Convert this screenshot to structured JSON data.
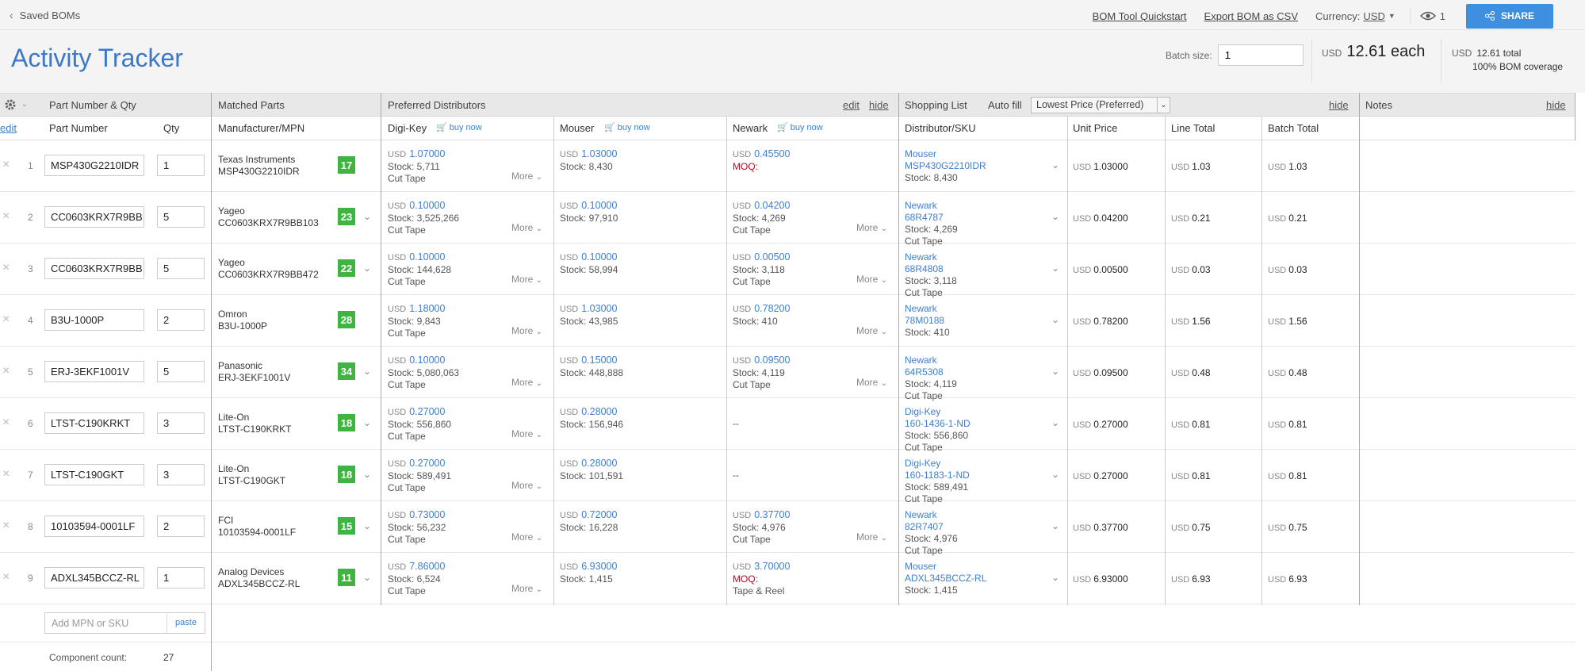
{
  "topbar": {
    "back_label": "Saved BOMs",
    "quickstart": "BOM Tool Quickstart",
    "export": "Export BOM as CSV",
    "currency_label": "Currency:",
    "currency_value": "USD",
    "viewers": "1",
    "share": "SHARE"
  },
  "header": {
    "title": "Activity Tracker",
    "batch_label": "Batch size:",
    "batch_value": "1",
    "each_currency": "USD",
    "each_value": "12.61 each",
    "total_currency": "USD",
    "total_value": "12.61 total",
    "coverage": "100% BOM coverage"
  },
  "groups": {
    "part": "Part Number & Qty",
    "matched": "Matched Parts",
    "preferred": "Preferred Distributors",
    "edit": "edit",
    "hide": "hide",
    "shopping": "Shopping List",
    "autofill": "Auto fill",
    "autofill_value": "Lowest Price (Preferred)",
    "notes": "Notes"
  },
  "columns": {
    "edit": "edit",
    "part_number": "Part Number",
    "qty": "Qty",
    "mfr": "Manufacturer/MPN",
    "digikey": "Digi-Key",
    "mouser": "Mouser",
    "newark": "Newark",
    "buy_now": "buy now",
    "sku": "Distributor/SKU",
    "unit": "Unit Price",
    "line": "Line Total",
    "batch": "Batch Total"
  },
  "rows": [
    {
      "n": "1",
      "part": "MSP430G2210IDR",
      "qty": "1",
      "mfr": "Texas Instruments",
      "mpn": "MSP430G2210IDR",
      "badge": "17",
      "dk": [
        "USD",
        "1.07000",
        "Stock: 5,711",
        "Cut Tape"
      ],
      "mo": [
        "USD",
        "1.03000",
        "Stock: 8,430",
        ""
      ],
      "nw": [
        "USD",
        "0.45500",
        "MOQ:",
        ""
      ],
      "sl": [
        "Mouser",
        "MSP430G2210IDR",
        "Stock: 8,430",
        ""
      ],
      "unit": "1.03000",
      "line": "1.03",
      "batch": "1.03"
    },
    {
      "n": "2",
      "part": "CC0603KRX7R9BB",
      "qty": "5",
      "mfr": "Yageo",
      "mpn": "CC0603KRX7R9BB103",
      "badge": "23",
      "dk": [
        "USD",
        "0.10000",
        "Stock: 3,525,266",
        "Cut Tape"
      ],
      "mo": [
        "USD",
        "0.10000",
        "Stock: 97,910",
        ""
      ],
      "nw": [
        "USD",
        "0.04200",
        "Stock: 4,269",
        "Cut Tape"
      ],
      "sl": [
        "Newark",
        "68R4787",
        "Stock: 4,269",
        "Cut Tape"
      ],
      "unit": "0.04200",
      "line": "0.21",
      "batch": "0.21"
    },
    {
      "n": "3",
      "part": "CC0603KRX7R9BB",
      "qty": "5",
      "mfr": "Yageo",
      "mpn": "CC0603KRX7R9BB472",
      "badge": "22",
      "dk": [
        "USD",
        "0.10000",
        "Stock: 144,628",
        "Cut Tape"
      ],
      "mo": [
        "USD",
        "0.10000",
        "Stock: 58,994",
        ""
      ],
      "nw": [
        "USD",
        "0.00500",
        "Stock: 3,118",
        "Cut Tape"
      ],
      "sl": [
        "Newark",
        "68R4808",
        "Stock: 3,118",
        "Cut Tape"
      ],
      "unit": "0.00500",
      "line": "0.03",
      "batch": "0.03"
    },
    {
      "n": "4",
      "part": "B3U-1000P",
      "qty": "2",
      "mfr": "Omron",
      "mpn": "B3U-1000P",
      "badge": "28",
      "dk": [
        "USD",
        "1.18000",
        "Stock: 9,843",
        "Cut Tape"
      ],
      "mo": [
        "USD",
        "1.03000",
        "Stock: 43,985",
        ""
      ],
      "nw": [
        "USD",
        "0.78200",
        "Stock: 410",
        ""
      ],
      "sl": [
        "Newark",
        "78M0188",
        "Stock: 410",
        ""
      ],
      "unit": "0.78200",
      "line": "1.56",
      "batch": "1.56"
    },
    {
      "n": "5",
      "part": "ERJ-3EKF1001V",
      "qty": "5",
      "mfr": "Panasonic",
      "mpn": "ERJ-3EKF1001V",
      "badge": "34",
      "dk": [
        "USD",
        "0.10000",
        "Stock: 5,080,063",
        "Cut Tape"
      ],
      "mo": [
        "USD",
        "0.15000",
        "Stock: 448,888",
        ""
      ],
      "nw": [
        "USD",
        "0.09500",
        "Stock: 4,119",
        "Cut Tape"
      ],
      "sl": [
        "Newark",
        "64R5308",
        "Stock: 4,119",
        "Cut Tape"
      ],
      "unit": "0.09500",
      "line": "0.48",
      "batch": "0.48"
    },
    {
      "n": "6",
      "part": "LTST-C190KRKT",
      "qty": "3",
      "mfr": "Lite-On",
      "mpn": "LTST-C190KRKT",
      "badge": "18",
      "dk": [
        "USD",
        "0.27000",
        "Stock: 556,860",
        "Cut Tape"
      ],
      "mo": [
        "USD",
        "0.28000",
        "Stock: 156,946",
        ""
      ],
      "nw": [
        "",
        "--",
        "",
        ""
      ],
      "sl": [
        "Digi-Key",
        "160-1436-1-ND",
        "Stock: 556,860",
        "Cut Tape"
      ],
      "unit": "0.27000",
      "line": "0.81",
      "batch": "0.81"
    },
    {
      "n": "7",
      "part": "LTST-C190GKT",
      "qty": "3",
      "mfr": "Lite-On",
      "mpn": "LTST-C190GKT",
      "badge": "18",
      "dk": [
        "USD",
        "0.27000",
        "Stock: 589,491",
        "Cut Tape"
      ],
      "mo": [
        "USD",
        "0.28000",
        "Stock: 101,591",
        ""
      ],
      "nw": [
        "",
        "--",
        "",
        ""
      ],
      "sl": [
        "Digi-Key",
        "160-1183-1-ND",
        "Stock: 589,491",
        "Cut Tape"
      ],
      "unit": "0.27000",
      "line": "0.81",
      "batch": "0.81"
    },
    {
      "n": "8",
      "part": "10103594-0001LF",
      "qty": "2",
      "mfr": "FCI",
      "mpn": "10103594-0001LF",
      "badge": "15",
      "dk": [
        "USD",
        "0.73000",
        "Stock: 56,232",
        "Cut Tape"
      ],
      "mo": [
        "USD",
        "0.72000",
        "Stock: 16,228",
        ""
      ],
      "nw": [
        "USD",
        "0.37700",
        "Stock: 4,976",
        "Cut Tape"
      ],
      "sl": [
        "Newark",
        "82R7407",
        "Stock: 4,976",
        "Cut Tape"
      ],
      "unit": "0.37700",
      "line": "0.75",
      "batch": "0.75"
    },
    {
      "n": "9",
      "part": "ADXL345BCCZ-RL",
      "qty": "1",
      "mfr": "Analog Devices",
      "mpn": "ADXL345BCCZ-RL",
      "badge": "11",
      "dk": [
        "USD",
        "7.86000",
        "Stock: 6,524",
        "Cut Tape"
      ],
      "mo": [
        "USD",
        "6.93000",
        "Stock: 1,415",
        ""
      ],
      "nw": [
        "USD",
        "3.70000",
        "MOQ:",
        "Tape & Reel"
      ],
      "sl": [
        "Mouser",
        "ADXL345BCCZ-RL",
        "Stock: 1,415",
        ""
      ],
      "unit": "6.93000",
      "line": "6.93",
      "batch": "6.93"
    }
  ],
  "more": "More",
  "add": {
    "placeholder": "Add MPN or SKU",
    "paste": "paste"
  },
  "footer": {
    "count_label": "Component count:",
    "count_value": "27"
  }
}
